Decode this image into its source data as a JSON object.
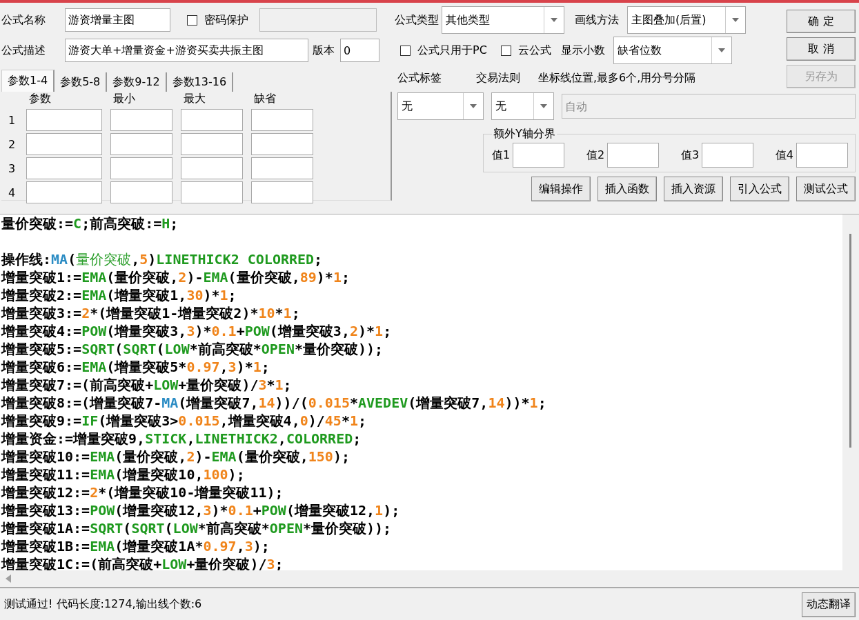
{
  "formula_name": {
    "label": "公式名称",
    "value": "游资增量主图"
  },
  "password": {
    "label": "密码保护",
    "checked": false
  },
  "description": {
    "label": "公式描述",
    "value": "游资大单+增量资金+游资买卖共振主图"
  },
  "version": {
    "label": "版本",
    "value": "0"
  },
  "param_tabs": [
    {
      "label": "参数1-4",
      "selected": true
    },
    {
      "label": "参数5-8",
      "selected": false
    },
    {
      "label": "参数9-12",
      "selected": false
    },
    {
      "label": "参数13-16",
      "selected": false
    }
  ],
  "param_columns": [
    "参数",
    "最小",
    "最大",
    "缺省"
  ],
  "param_rows": [
    "1",
    "2",
    "3",
    "4"
  ],
  "formula_type": {
    "label": "公式类型",
    "value": "其他类型"
  },
  "draw_method": {
    "label": "画线方法",
    "value": "主图叠加(后置)"
  },
  "pc_only": {
    "label": "公式只用于PC",
    "checked": false
  },
  "cloud": {
    "label": "云公式",
    "checked": false
  },
  "decimals": {
    "label": "显示小数",
    "value": "缺省位数"
  },
  "dialog_buttons": [
    {
      "label": "确 定",
      "disabled": false
    },
    {
      "label": "取 消",
      "disabled": false
    },
    {
      "label": "另存为",
      "disabled": true
    }
  ],
  "formula_tag": {
    "label": "公式标签",
    "value": "无"
  },
  "trade_rule": {
    "label": "交易法则",
    "value": "无"
  },
  "axis_lines": {
    "label": "坐标线位置,最多6个,用分号分隔",
    "placeholder": "自动"
  },
  "y_axis": {
    "title": "额外Y轴分界",
    "fields": [
      "值1",
      "值2",
      "值3",
      "值4"
    ]
  },
  "actions": [
    "编辑操作",
    "插入函数",
    "插入资源",
    "引入公式",
    "测试公式"
  ],
  "code_lines": [
    {
      "kind": "code",
      "tokens": [
        {
          "kind": "text",
          "text": "量价突破:="
        },
        {
          "kind": "func",
          "text": "C"
        },
        {
          "kind": "text",
          "text": ";前高突破:="
        },
        {
          "kind": "func",
          "text": "H"
        },
        {
          "kind": "text",
          "text": ";"
        }
      ]
    },
    {
      "kind": "blank"
    },
    {
      "kind": "code",
      "tokens": [
        {
          "kind": "text",
          "text": "操作线:"
        },
        {
          "kind": "blue",
          "text": "MA"
        },
        {
          "kind": "text",
          "text": "("
        },
        {
          "kind": "var",
          "text": "量价突破"
        },
        {
          "kind": "text",
          "text": ","
        },
        {
          "kind": "num",
          "text": "5"
        },
        {
          "kind": "text",
          "text": ")"
        },
        {
          "kind": "func",
          "text": "LINETHICK2 COLORRED"
        },
        {
          "kind": "text",
          "text": ";"
        }
      ]
    },
    {
      "kind": "code",
      "tokens": [
        {
          "kind": "text",
          "text": "增量突破1:="
        },
        {
          "kind": "func",
          "text": "EMA"
        },
        {
          "kind": "text",
          "text": "(量价突破,"
        },
        {
          "kind": "num",
          "text": "2"
        },
        {
          "kind": "text",
          "text": ")-"
        },
        {
          "kind": "func",
          "text": "EMA"
        },
        {
          "kind": "text",
          "text": "(量价突破,"
        },
        {
          "kind": "num",
          "text": "89"
        },
        {
          "kind": "text",
          "text": ")*"
        },
        {
          "kind": "num",
          "text": "1"
        },
        {
          "kind": "text",
          "text": ";"
        }
      ]
    },
    {
      "kind": "code",
      "tokens": [
        {
          "kind": "text",
          "text": "增量突破2:="
        },
        {
          "kind": "func",
          "text": "EMA"
        },
        {
          "kind": "text",
          "text": "(增量突破1,"
        },
        {
          "kind": "num",
          "text": "30"
        },
        {
          "kind": "text",
          "text": ")*"
        },
        {
          "kind": "num",
          "text": "1"
        },
        {
          "kind": "text",
          "text": ";"
        }
      ]
    },
    {
      "kind": "code",
      "tokens": [
        {
          "kind": "text",
          "text": "增量突破3:="
        },
        {
          "kind": "num",
          "text": "2"
        },
        {
          "kind": "text",
          "text": "*(增量突破1-增量突破2)*"
        },
        {
          "kind": "num",
          "text": "10"
        },
        {
          "kind": "text",
          "text": "*"
        },
        {
          "kind": "num",
          "text": "1"
        },
        {
          "kind": "text",
          "text": ";"
        }
      ]
    },
    {
      "kind": "code",
      "tokens": [
        {
          "kind": "text",
          "text": "增量突破4:="
        },
        {
          "kind": "func",
          "text": "POW"
        },
        {
          "kind": "text",
          "text": "(增量突破3,"
        },
        {
          "kind": "num",
          "text": "3"
        },
        {
          "kind": "text",
          "text": ")*"
        },
        {
          "kind": "num",
          "text": "0.1"
        },
        {
          "kind": "text",
          "text": "+"
        },
        {
          "kind": "func",
          "text": "POW"
        },
        {
          "kind": "text",
          "text": "(增量突破3,"
        },
        {
          "kind": "num",
          "text": "2"
        },
        {
          "kind": "text",
          "text": ")*"
        },
        {
          "kind": "num",
          "text": "1"
        },
        {
          "kind": "text",
          "text": ";"
        }
      ]
    },
    {
      "kind": "code",
      "tokens": [
        {
          "kind": "text",
          "text": "增量突破5:="
        },
        {
          "kind": "func",
          "text": "SQRT"
        },
        {
          "kind": "text",
          "text": "("
        },
        {
          "kind": "func",
          "text": "SQRT"
        },
        {
          "kind": "text",
          "text": "("
        },
        {
          "kind": "func",
          "text": "LOW"
        },
        {
          "kind": "text",
          "text": "*前高突破*"
        },
        {
          "kind": "func",
          "text": "OPEN"
        },
        {
          "kind": "text",
          "text": "*量价突破));"
        }
      ]
    },
    {
      "kind": "code",
      "tokens": [
        {
          "kind": "text",
          "text": "增量突破6:="
        },
        {
          "kind": "func",
          "text": "EMA"
        },
        {
          "kind": "text",
          "text": "(增量突破5*"
        },
        {
          "kind": "num",
          "text": "0.97"
        },
        {
          "kind": "text",
          "text": ","
        },
        {
          "kind": "num",
          "text": "3"
        },
        {
          "kind": "text",
          "text": ")*"
        },
        {
          "kind": "num",
          "text": "1"
        },
        {
          "kind": "text",
          "text": ";"
        }
      ]
    },
    {
      "kind": "code",
      "tokens": [
        {
          "kind": "text",
          "text": "增量突破7:=(前高突破+"
        },
        {
          "kind": "func",
          "text": "LOW"
        },
        {
          "kind": "text",
          "text": "+量价突破)/"
        },
        {
          "kind": "num",
          "text": "3"
        },
        {
          "kind": "text",
          "text": "*"
        },
        {
          "kind": "num",
          "text": "1"
        },
        {
          "kind": "text",
          "text": ";"
        }
      ]
    },
    {
      "kind": "code",
      "tokens": [
        {
          "kind": "text",
          "text": "增量突破8:=(增量突破7-"
        },
        {
          "kind": "blue",
          "text": "MA"
        },
        {
          "kind": "text",
          "text": "(增量突破7,"
        },
        {
          "kind": "num",
          "text": "14"
        },
        {
          "kind": "text",
          "text": "))/("
        },
        {
          "kind": "num",
          "text": "0.015"
        },
        {
          "kind": "text",
          "text": "*"
        },
        {
          "kind": "func",
          "text": "AVEDEV"
        },
        {
          "kind": "text",
          "text": "(增量突破7,"
        },
        {
          "kind": "num",
          "text": "14"
        },
        {
          "kind": "text",
          "text": "))*"
        },
        {
          "kind": "num",
          "text": "1"
        },
        {
          "kind": "text",
          "text": ";"
        }
      ]
    },
    {
      "kind": "code",
      "tokens": [
        {
          "kind": "text",
          "text": "增量突破9:="
        },
        {
          "kind": "func",
          "text": "IF"
        },
        {
          "kind": "text",
          "text": "(增量突破3>"
        },
        {
          "kind": "num",
          "text": "0.015"
        },
        {
          "kind": "text",
          "text": ",增量突破4,"
        },
        {
          "kind": "num",
          "text": "0"
        },
        {
          "kind": "text",
          "text": ")/"
        },
        {
          "kind": "num",
          "text": "45"
        },
        {
          "kind": "text",
          "text": "*"
        },
        {
          "kind": "num",
          "text": "1"
        },
        {
          "kind": "text",
          "text": ";"
        }
      ]
    },
    {
      "kind": "code",
      "tokens": [
        {
          "kind": "text",
          "text": "增量资金:=增量突破9,"
        },
        {
          "kind": "func",
          "text": "STICK"
        },
        {
          "kind": "text",
          "text": ","
        },
        {
          "kind": "func",
          "text": "LINETHICK2"
        },
        {
          "kind": "text",
          "text": ","
        },
        {
          "kind": "func",
          "text": "COLORRED"
        },
        {
          "kind": "text",
          "text": ";"
        }
      ]
    },
    {
      "kind": "code",
      "tokens": [
        {
          "kind": "text",
          "text": "增量突破10:="
        },
        {
          "kind": "func",
          "text": "EMA"
        },
        {
          "kind": "text",
          "text": "(量价突破,"
        },
        {
          "kind": "num",
          "text": "2"
        },
        {
          "kind": "text",
          "text": ")-"
        },
        {
          "kind": "func",
          "text": "EMA"
        },
        {
          "kind": "text",
          "text": "(量价突破,"
        },
        {
          "kind": "num",
          "text": "150"
        },
        {
          "kind": "text",
          "text": ");"
        }
      ]
    },
    {
      "kind": "code",
      "tokens": [
        {
          "kind": "text",
          "text": "增量突破11:="
        },
        {
          "kind": "func",
          "text": "EMA"
        },
        {
          "kind": "text",
          "text": "(增量突破10,"
        },
        {
          "kind": "num",
          "text": "100"
        },
        {
          "kind": "text",
          "text": ");"
        }
      ]
    },
    {
      "kind": "code",
      "tokens": [
        {
          "kind": "text",
          "text": "增量突破12:="
        },
        {
          "kind": "num",
          "text": "2"
        },
        {
          "kind": "text",
          "text": "*(增量突破10-增量突破11);"
        }
      ]
    },
    {
      "kind": "code",
      "tokens": [
        {
          "kind": "text",
          "text": "增量突破13:="
        },
        {
          "kind": "func",
          "text": "POW"
        },
        {
          "kind": "text",
          "text": "(增量突破12,"
        },
        {
          "kind": "num",
          "text": "3"
        },
        {
          "kind": "text",
          "text": ")*"
        },
        {
          "kind": "num",
          "text": "0.1"
        },
        {
          "kind": "text",
          "text": "+"
        },
        {
          "kind": "func",
          "text": "POW"
        },
        {
          "kind": "text",
          "text": "(增量突破12,"
        },
        {
          "kind": "num",
          "text": "1"
        },
        {
          "kind": "text",
          "text": ");"
        }
      ]
    },
    {
      "kind": "code",
      "tokens": [
        {
          "kind": "text",
          "text": "增量突破1A:="
        },
        {
          "kind": "func",
          "text": "SQRT"
        },
        {
          "kind": "text",
          "text": "("
        },
        {
          "kind": "func",
          "text": "SQRT"
        },
        {
          "kind": "text",
          "text": "("
        },
        {
          "kind": "func",
          "text": "LOW"
        },
        {
          "kind": "text",
          "text": "*前高突破*"
        },
        {
          "kind": "func",
          "text": "OPEN"
        },
        {
          "kind": "text",
          "text": "*量价突破));"
        }
      ]
    },
    {
      "kind": "code",
      "tokens": [
        {
          "kind": "text",
          "text": "增量突破1B:="
        },
        {
          "kind": "func",
          "text": "EMA"
        },
        {
          "kind": "text",
          "text": "(增量突破1A*"
        },
        {
          "kind": "num",
          "text": "0.97"
        },
        {
          "kind": "text",
          "text": ","
        },
        {
          "kind": "num",
          "text": "3"
        },
        {
          "kind": "text",
          "text": ");"
        }
      ]
    },
    {
      "kind": "code",
      "tokens": [
        {
          "kind": "text",
          "text": "增量突破1C:=(前高突破+"
        },
        {
          "kind": "func",
          "text": "LOW"
        },
        {
          "kind": "text",
          "text": "+量价突破)/"
        },
        {
          "kind": "num",
          "text": "3"
        },
        {
          "kind": "text",
          "text": ";"
        }
      ]
    }
  ],
  "status": "测试通过! 代码长度:1274,输出线个数:6",
  "translate_button": "动态翻译"
}
